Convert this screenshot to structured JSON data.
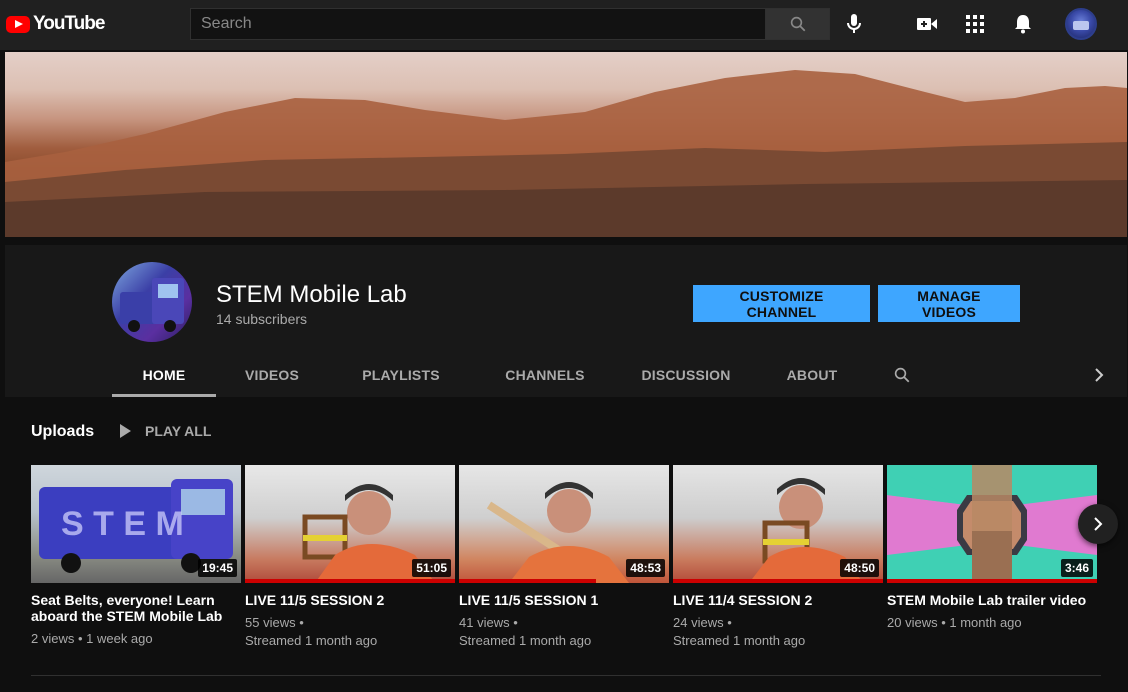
{
  "app": {
    "logo_text": "YouTube",
    "brand_color": "#ff0000",
    "accent_color": "#3ea6ff"
  },
  "search": {
    "placeholder": "Search",
    "value": ""
  },
  "topbar_icons": [
    "search-icon",
    "microphone-icon",
    "create-video-icon",
    "apps-grid-icon",
    "notifications-bell-icon",
    "account-avatar"
  ],
  "channel": {
    "name": "STEM Mobile Lab",
    "subscribers": "14 subscribers",
    "customize_label": "CUSTOMIZE CHANNEL",
    "manage_label": "MANAGE VIDEOS"
  },
  "tabs": [
    {
      "label": "HOME",
      "active": true
    },
    {
      "label": "VIDEOS",
      "active": false
    },
    {
      "label": "PLAYLISTS",
      "active": false
    },
    {
      "label": "CHANNELS",
      "active": false
    },
    {
      "label": "DISCUSSION",
      "active": false
    },
    {
      "label": "ABOUT",
      "active": false
    }
  ],
  "uploads": {
    "title": "Uploads",
    "play_all_label": "PLAY ALL",
    "videos": [
      {
        "title": "Seat Belts, everyone! Learn aboard the STEM Mobile Lab",
        "duration": "19:45",
        "views": "2 views",
        "age": "1 week ago",
        "meta_line1": "2 views • 1 week ago",
        "meta_line2": "",
        "watched": 0
      },
      {
        "title": "LIVE 11/5 SESSION 2",
        "duration": "51:05",
        "views": "55 views",
        "age": "Streamed 1 month ago",
        "meta_line1": "55 views •",
        "meta_line2": "Streamed 1 month ago",
        "watched": 1
      },
      {
        "title": "LIVE 11/5 SESSION 1",
        "duration": "48:53",
        "views": "41 views",
        "age": "Streamed 1 month ago",
        "meta_line1": "41 views •",
        "meta_line2": "Streamed 1 month ago",
        "watched": 0.65
      },
      {
        "title": "LIVE 11/4 SESSION 2",
        "duration": "48:50",
        "views": "24 views",
        "age": "Streamed 1 month ago",
        "meta_line1": "24 views •",
        "meta_line2": "Streamed 1 month ago",
        "watched": 1
      },
      {
        "title": "STEM Mobile Lab trailer video",
        "duration": "3:46",
        "views": "20 views",
        "age": "1 month ago",
        "meta_line1": "20 views • 1 month ago",
        "meta_line2": "",
        "watched": 1
      }
    ]
  }
}
